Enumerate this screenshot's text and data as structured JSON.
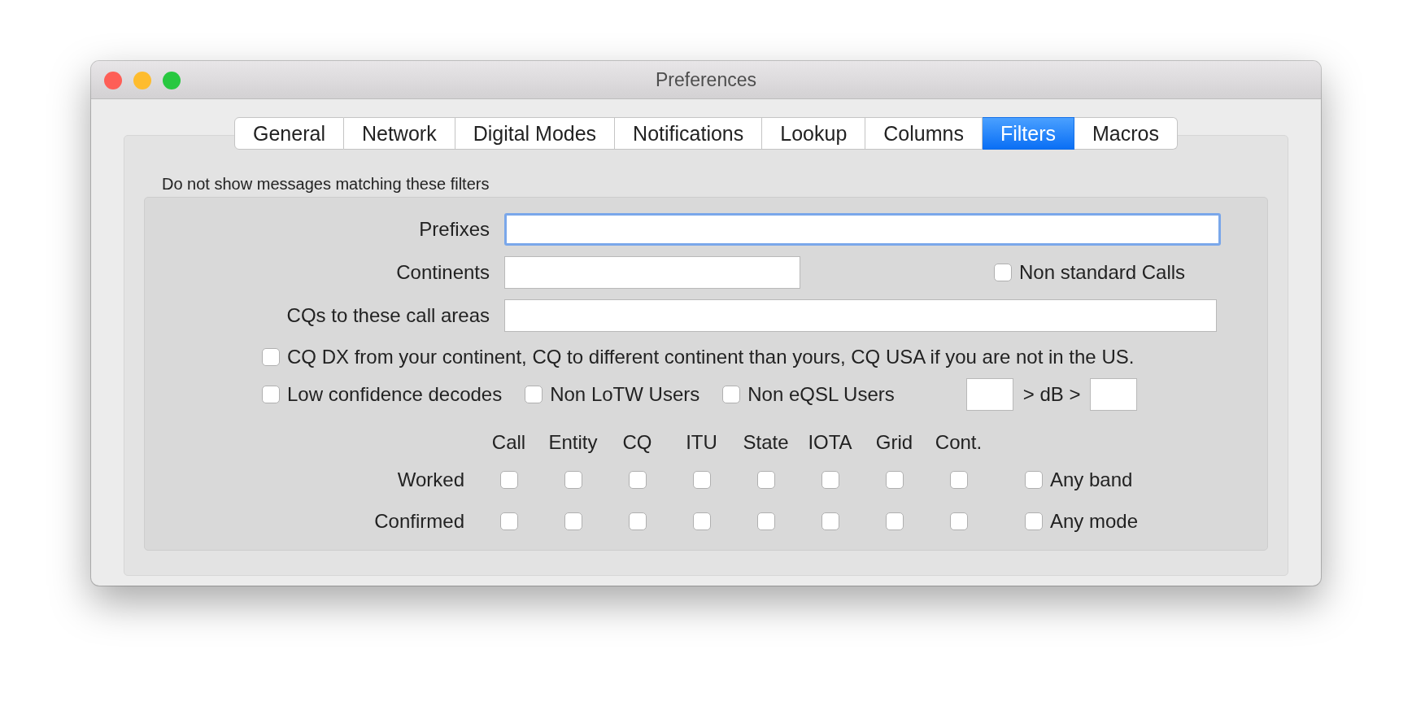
{
  "window": {
    "title": "Preferences"
  },
  "tabs": [
    {
      "label": "General",
      "selected": false
    },
    {
      "label": "Network",
      "selected": false
    },
    {
      "label": "Digital Modes",
      "selected": false
    },
    {
      "label": "Notifications",
      "selected": false
    },
    {
      "label": "Lookup",
      "selected": false
    },
    {
      "label": "Columns",
      "selected": false
    },
    {
      "label": "Filters",
      "selected": true
    },
    {
      "label": "Macros",
      "selected": false
    }
  ],
  "filters": {
    "heading": "Do not show messages matching these filters",
    "prefixes": {
      "label": "Prefixes",
      "focused": true
    },
    "continents": {
      "label": "Continents",
      "focused": false
    },
    "non_standard_calls": {
      "label": "Non standard Calls",
      "checked": false
    },
    "cq_areas": {
      "label": "CQs to these call areas",
      "focused": false
    },
    "cq_dx": {
      "label": "CQ DX from your continent, CQ to different continent than yours, CQ USA if you are not in the US.",
      "checked": false
    },
    "options": [
      {
        "label": "Low confidence decodes",
        "checked": false
      },
      {
        "label": "Non LoTW Users",
        "checked": false
      },
      {
        "label": "Non eQSL Users",
        "checked": false
      }
    ],
    "db_label": "> dB >",
    "grid": {
      "columns": [
        "Call",
        "Entity",
        "CQ",
        "ITU",
        "State",
        "IOTA",
        "Grid",
        "Cont."
      ],
      "rows": [
        {
          "label": "Worked",
          "cells": [
            {
              "checked": false
            },
            {
              "checked": false
            },
            {
              "checked": false
            },
            {
              "checked": false
            },
            {
              "checked": false
            },
            {
              "checked": false
            },
            {
              "checked": false
            },
            {
              "checked": false
            }
          ],
          "extra": {
            "label": "Any band",
            "checked": false
          }
        },
        {
          "label": "Confirmed",
          "cells": [
            {
              "checked": false
            },
            {
              "checked": false
            },
            {
              "checked": false
            },
            {
              "checked": false
            },
            {
              "checked": false
            },
            {
              "checked": false
            },
            {
              "checked": false
            },
            {
              "checked": false
            }
          ],
          "extra": {
            "label": "Any mode",
            "checked": false
          }
        }
      ]
    }
  }
}
